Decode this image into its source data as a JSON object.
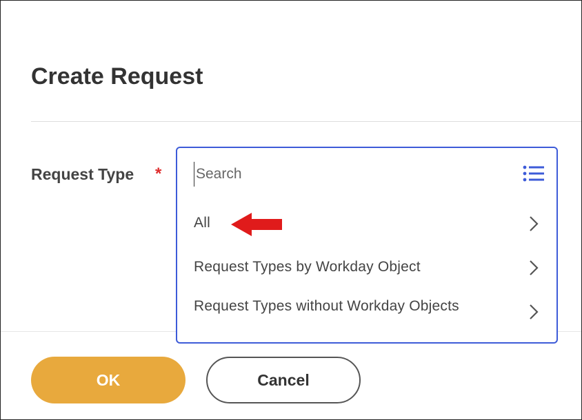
{
  "dialog": {
    "title": "Create Request"
  },
  "field": {
    "label": "Request Type",
    "required_marker": "*"
  },
  "search": {
    "placeholder": "Search",
    "value": ""
  },
  "options": [
    {
      "label": "All"
    },
    {
      "label": "Request Types by Workday Object"
    },
    {
      "label": "Request Types without Workday Objects"
    }
  ],
  "buttons": {
    "ok": "OK",
    "cancel": "Cancel"
  },
  "colors": {
    "accent_blue": "#3d5bd8",
    "ok_button": "#e8a93d",
    "required_red": "#de2d2d",
    "annotation_arrow": "#e01b1b"
  },
  "icons": {
    "list": "list-icon",
    "chevron": "chevron-right-icon",
    "annotation": "red-arrow-annotation"
  }
}
